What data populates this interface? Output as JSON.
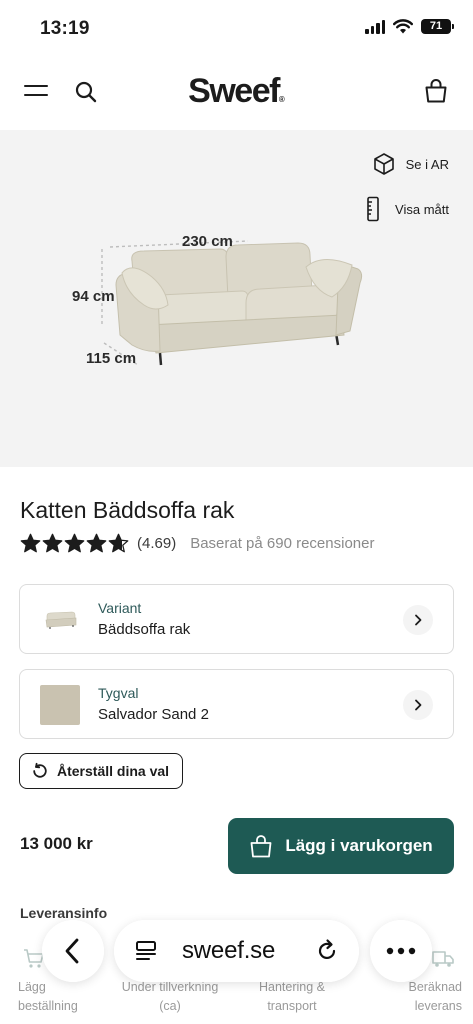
{
  "status": {
    "time": "13:19",
    "battery": "71"
  },
  "header": {
    "logo": "Sweef",
    "logo_mark": "®"
  },
  "hero": {
    "ar_label": "Se i AR",
    "measure_label": "Visa mått",
    "dim_width": "230 cm",
    "dim_height": "94 cm",
    "dim_depth": "115 cm"
  },
  "product": {
    "title": "Katten Bäddsoffa rak",
    "rating": 4.69,
    "rating_text": "(4.69)",
    "reviews_text": "Baserat på 690 recensioner"
  },
  "options": {
    "variant_label": "Variant",
    "variant_value": "Bäddsoffa rak",
    "fabric_label": "Tygval",
    "fabric_value": "Salvador Sand 2",
    "fabric_swatch_color": "#c9c2b0"
  },
  "reset_label": "Återställ dina val",
  "price": "13 000 kr",
  "add_to_cart_label": "Lägg i varukorgen",
  "delivery": {
    "title": "Leveransinfo",
    "steps": [
      {
        "line1": "Lägg",
        "line2": "beställning"
      },
      {
        "line1": "Under tillverkning",
        "line2": "(ca)"
      },
      {
        "line1": "Hantering &",
        "line2": "transport"
      },
      {
        "line1": "Beräknad",
        "line2": "leverans"
      }
    ]
  },
  "browser": {
    "url": "sweef.se"
  },
  "colors": {
    "accent": "#1e5a54",
    "hero_bg": "#f3f3f3",
    "sofa": "#d9d6c8",
    "label_teal": "#2f5a5a"
  }
}
